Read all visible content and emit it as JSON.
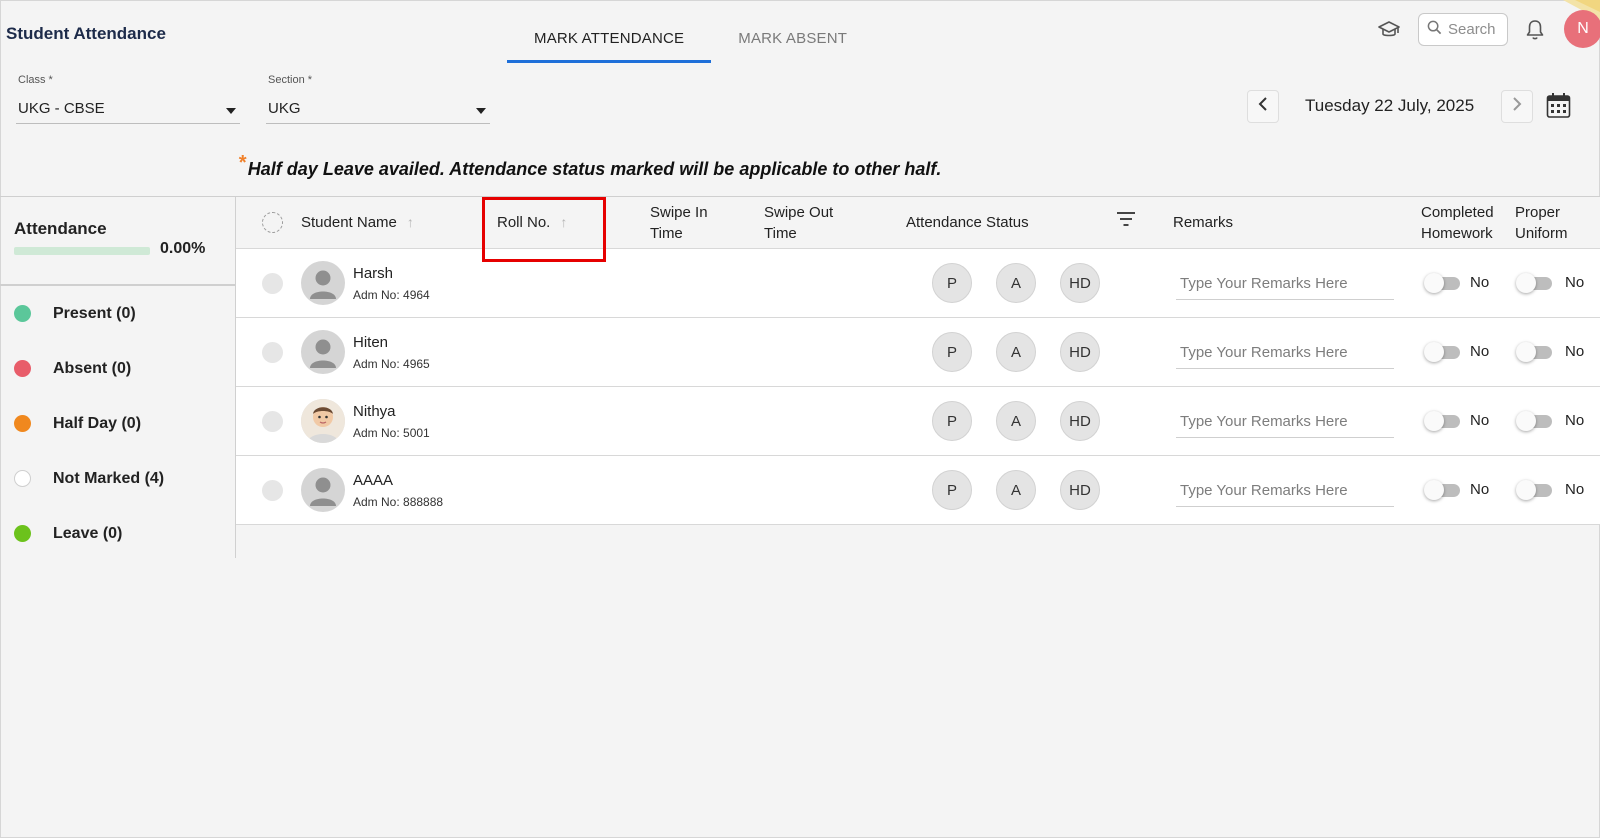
{
  "header": {
    "title": "Student Attendance",
    "tabs": [
      {
        "label": "MARK ATTENDANCE",
        "active": true
      },
      {
        "label": "MARK ABSENT",
        "active": false
      }
    ],
    "search_placeholder": "Search",
    "user_initial": "N",
    "icons": [
      "graduation-cap-icon",
      "search-icon",
      "bell-icon"
    ]
  },
  "filters": {
    "class": {
      "label": "Class *",
      "value": "UKG - CBSE"
    },
    "section": {
      "label": "Section *",
      "value": "UKG"
    }
  },
  "date": {
    "text": "Tuesday 22 July, 2025"
  },
  "notice": {
    "star": "*",
    "text": "Half day Leave availed. Attendance status marked will be applicable to other half."
  },
  "summary": {
    "title": "Attendance",
    "percent": "0.00%",
    "progress_fraction": 0,
    "items": [
      {
        "label": "Present (0)",
        "color": "#5bc79a"
      },
      {
        "label": "Absent (0)",
        "color": "#e85d6a"
      },
      {
        "label": "Half Day (0)",
        "color": "#f0881e"
      },
      {
        "label": "Not Marked (4)",
        "color": "#ffffff"
      },
      {
        "label": "Leave (0)",
        "color": "#6cc21c"
      }
    ]
  },
  "table": {
    "columns": {
      "student_name": "Student Name",
      "roll_no": "Roll No.",
      "swipe_in_1": "Swipe In",
      "swipe_in_2": "Time",
      "swipe_out_1": "Swipe Out",
      "swipe_out_2": "Time",
      "attendance_status": "Attendance Status",
      "remarks": "Remarks",
      "homework_1": "Completed",
      "homework_2": "Homework",
      "uniform_1": "Proper",
      "uniform_2": "Uniform"
    },
    "status_buttons": {
      "present": "P",
      "absent": "A",
      "half_day": "HD"
    },
    "remark_placeholder": "Type Your Remarks Here",
    "toggle_label": "No",
    "rows": [
      {
        "name": "Harsh",
        "adm": "Adm No: 4964",
        "photo": false
      },
      {
        "name": "Hiten",
        "adm": "Adm No: 4965",
        "photo": false
      },
      {
        "name": "Nithya",
        "adm": "Adm No: 5001",
        "photo": true
      },
      {
        "name": "AAAA",
        "adm": "Adm No: 888888",
        "photo": false
      }
    ]
  },
  "colors": {
    "accent": "#1e6fd9",
    "highlight": "#e60000",
    "avatar": "#e8707a"
  }
}
